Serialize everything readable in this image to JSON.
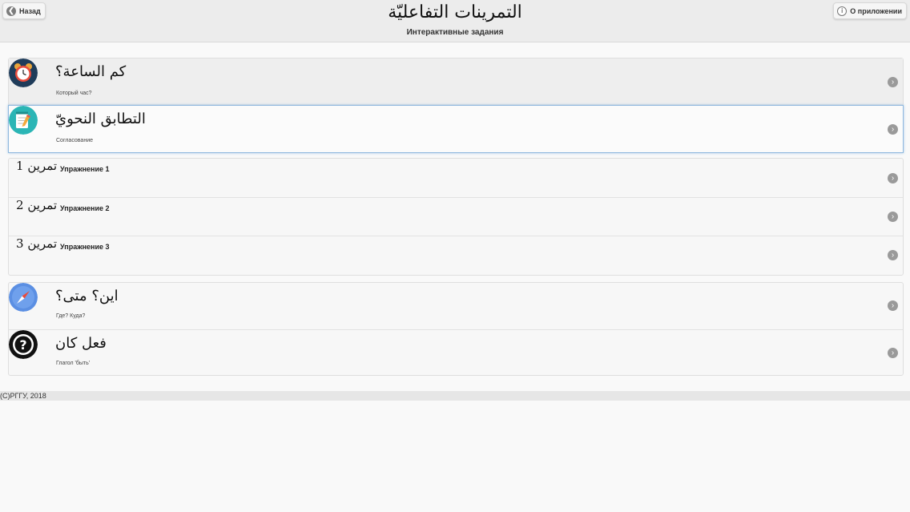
{
  "header": {
    "back_label": "Назад",
    "about_label": "О приложении",
    "title": "التمرينات التفاعليّة",
    "subtitle": "Интерактивные задания"
  },
  "topics": [
    {
      "title_ar": "كم الساعة؟",
      "subtitle_ru": "Который час?",
      "icon": "alarm-clock-icon"
    },
    {
      "title_ar": "التطابق النحويّ",
      "subtitle_ru": "Согласование",
      "icon": "notepad-pencil-icon"
    }
  ],
  "exercises": [
    {
      "label_ar": "تمرين 1",
      "label_ru": "Упражнение 1"
    },
    {
      "label_ar": "تمرين 2",
      "label_ru": "Упражнение 2"
    },
    {
      "label_ar": "تمرين 3",
      "label_ru": "Упражнение 3"
    }
  ],
  "topics2": [
    {
      "title_ar": "اين؟ متى؟",
      "subtitle_ru": "Где? Куда?",
      "icon": "compass-icon"
    },
    {
      "title_ar": "فعل كان",
      "subtitle_ru": "Глагол 'быть'",
      "icon": "question-mark-icon"
    }
  ],
  "footer": "(C)РГГУ, 2018",
  "colors": {
    "header_bg": "#ececec",
    "selected_border": "#8fb8de",
    "chevron": "#9a9a9a"
  }
}
